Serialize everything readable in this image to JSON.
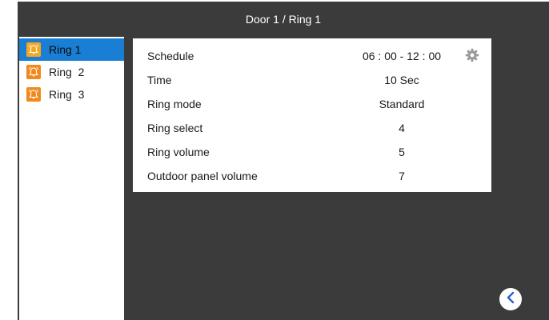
{
  "header": {
    "title": "Door 1 / Ring 1"
  },
  "sidebar": {
    "items": [
      {
        "label": "Ring 1",
        "selected": true
      },
      {
        "label": "Ring  2",
        "selected": false
      },
      {
        "label": "Ring  3",
        "selected": false
      }
    ]
  },
  "settings": {
    "rows": [
      {
        "name": "Schedule",
        "value": "06 : 00 - 12 : 00"
      },
      {
        "name": "Time",
        "value": "10 Sec"
      },
      {
        "name": "Ring mode",
        "value": "Standard"
      },
      {
        "name": "Ring select",
        "value": "4"
      },
      {
        "name": "Ring volume",
        "value": "5"
      },
      {
        "name": "Outdoor panel volume",
        "value": "7"
      }
    ]
  },
  "icons": {
    "bell": "bell-icon",
    "gear": "gear-icon",
    "back": "back-arrow-icon"
  },
  "colors": {
    "background": "#3b3b3b",
    "accent": "#1a7fd4",
    "bell": "#f08a1c"
  }
}
